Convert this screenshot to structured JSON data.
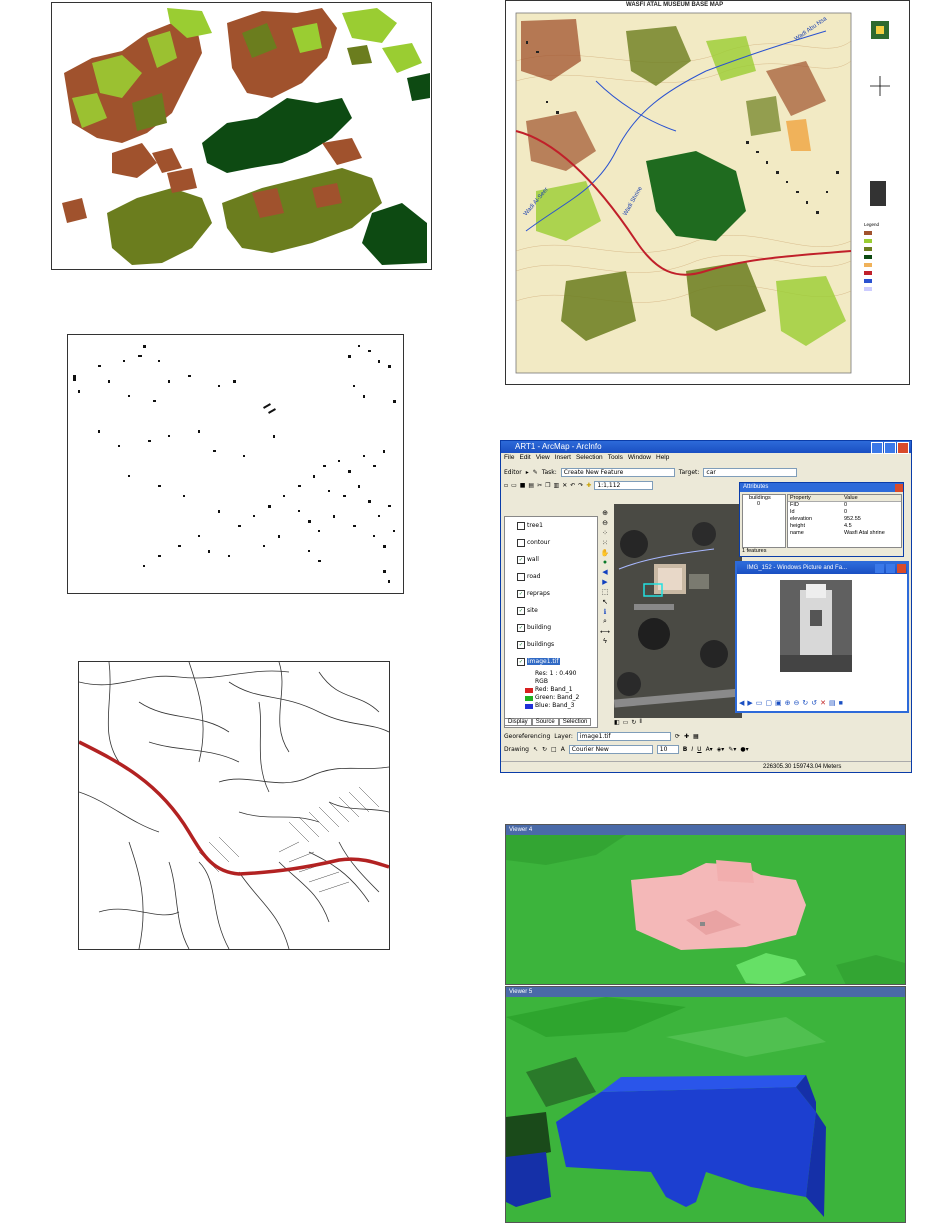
{
  "landuse_map": {},
  "buildings_map": {},
  "roads_map": {},
  "base_map": {
    "title": "WASFI ATAL MUSEUM BASE MAP",
    "labels": [
      "Wadi Al-Seer",
      "Wadi Shrine",
      "Wadi Abu Nsa",
      "Wadi Al-Seer"
    ],
    "legend_title": "Legend"
  },
  "arcmap": {
    "window_title": "ART1 - ArcMap - ArcInfo",
    "menus": [
      "File",
      "Edit",
      "View",
      "Insert",
      "Selection",
      "Tools",
      "Window",
      "Help"
    ],
    "editor_label": "Editor",
    "task_label": "Task:",
    "task_value": "Create New Feature",
    "target_label": "Target:",
    "target_value": "car",
    "scale_value": "1:1,112",
    "toc_layers": [
      {
        "name": "tree1",
        "checked": false
      },
      {
        "name": "contour",
        "checked": false
      },
      {
        "name": "wall",
        "checked": true
      },
      {
        "name": "road",
        "checked": false
      },
      {
        "name": "repraps",
        "checked": true
      },
      {
        "name": "site",
        "checked": true
      },
      {
        "name": "building",
        "checked": true
      },
      {
        "name": "buildings",
        "checked": true
      },
      {
        "name": "image1.tif",
        "checked": true
      }
    ],
    "raster_info": {
      "res": "Res: 1 : 0.490",
      "rgb": "RGB",
      "red": "Red:   Band_1",
      "green": "Green: Band_2",
      "blue": "Blue:   Band_3"
    },
    "toc_tabs": [
      "Display",
      "Source",
      "Selection"
    ],
    "attributes": {
      "title": "Attributes",
      "tree_root": "buildings",
      "tree_child": "0",
      "col_property": "Property",
      "col_value": "Value",
      "rows": [
        {
          "property": "FID",
          "value": "0"
        },
        {
          "property": "Id",
          "value": "0"
        },
        {
          "property": "elevation",
          "value": "952.55"
        },
        {
          "property": "height",
          "value": "4.5"
        },
        {
          "property": "name",
          "value": "Wasfi Atal shrine"
        }
      ],
      "footer": "1 features"
    },
    "picture_viewer_title": "IMG_152 - Windows Picture and Fa...",
    "georef_label": "Georeferencing",
    "layer_label": "Layer:",
    "layer_value": "image1.tif",
    "drawing_label": "Drawing",
    "font_value": "Courier New",
    "font_size": "10",
    "bold": "B",
    "italic": "I",
    "underline": "U",
    "status_coords": "226305.30  159743.04 Meters"
  },
  "viewer4": {
    "title": "Viewer 4"
  },
  "viewer5": {
    "title": "Viewer 5"
  },
  "colors": {
    "brown": "#a0522d",
    "light_green": "#9acd32",
    "olive": "#6b7d1e",
    "dark_green": "#0d4a12",
    "road_red": "#b22222",
    "pink_building": "#f4b8b8",
    "blue_building": "#1c3fd0",
    "viewer_green": "#3cb43c"
  }
}
